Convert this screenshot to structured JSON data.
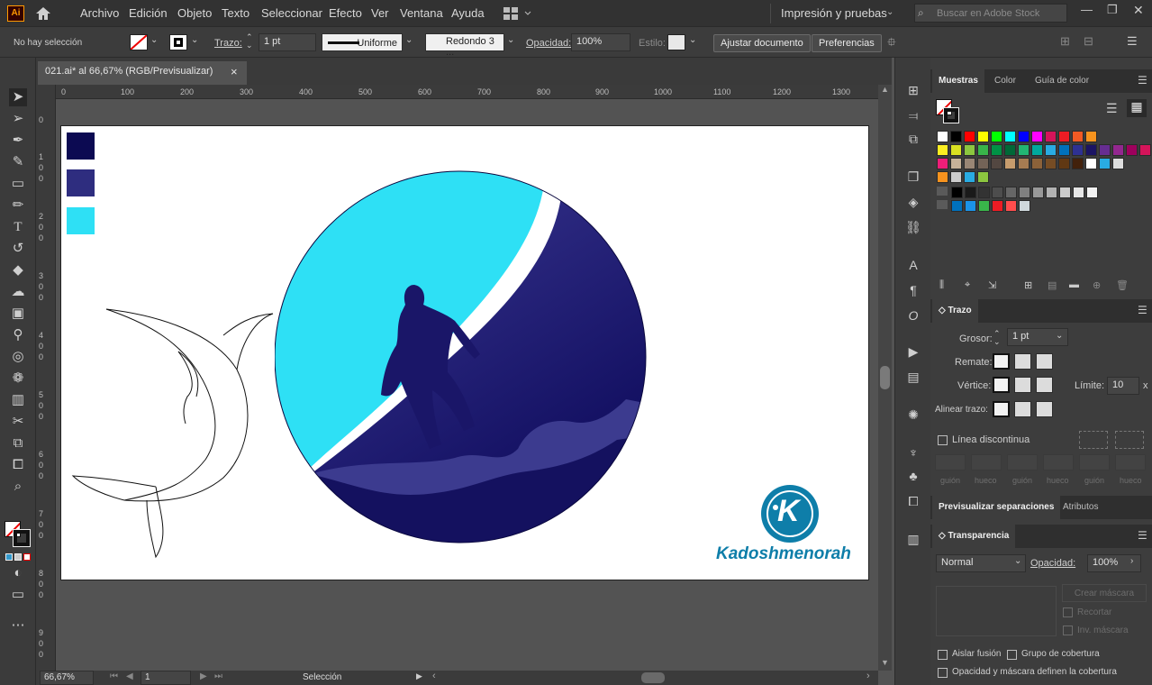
{
  "menubar": {
    "app_icon": "Ai",
    "items": [
      "Archivo",
      "Edición",
      "Objeto",
      "Texto",
      "Seleccionar",
      "Efecto",
      "Ver",
      "Ventana",
      "Ayuda"
    ],
    "workspace": "Impresión y pruebas",
    "search_placeholder": "Buscar en Adobe Stock"
  },
  "control": {
    "selection": "No hay selección",
    "stroke_label": "Trazo:",
    "stroke_value": "1 pt",
    "profile": "Uniforme",
    "brush": "Redondo 3 ...",
    "opacity_label": "Opacidad:",
    "opacity": "100%",
    "style_label": "Estilo:",
    "adjust_doc": "Ajustar documento",
    "prefs": "Preferencias"
  },
  "document": {
    "tab_title": "021.ai* al 66,67% (RGB/Previsualizar)",
    "close": "×"
  },
  "ruler": {
    "h_ticks": [
      "0",
      "100",
      "200",
      "300",
      "400",
      "500",
      "600",
      "700",
      "800",
      "900",
      "1000",
      "1100",
      "1200",
      "1300"
    ],
    "v_ticks": [
      "0",
      "100",
      "200",
      "300",
      "400",
      "500",
      "600",
      "700",
      "800",
      "900"
    ]
  },
  "artwork": {
    "logo_letter": "K",
    "brand": "Kadoshmenorah",
    "palette": [
      "#0c0a52",
      "#2e2d7f",
      "#2ee0f5"
    ]
  },
  "status": {
    "zoom": "66,67%",
    "artboard": "1",
    "tool": "Selección"
  },
  "swatches_panel": {
    "tabs": [
      "Muestras",
      "Color",
      "Guía de color"
    ],
    "rows": [
      [
        "#ffffff",
        "#000000",
        "#ff0000",
        "#ffff00",
        "#00ff00",
        "#00ffff",
        "#0000ff",
        "#ff00ff",
        "#d4145a",
        "#ed1c24",
        "#f15a24",
        "#f7931e"
      ],
      [
        "#fcee21",
        "#d9e021",
        "#8cc63f",
        "#39b54a",
        "#009245",
        "#006837",
        "#22b573",
        "#00a99d",
        "#29abe2",
        "#0071bc",
        "#2e3192",
        "#1b1464",
        "#662d91",
        "#93278f",
        "#9e005d",
        "#d4145a"
      ],
      [
        "#ed1e79",
        "#c7b299",
        "#998675",
        "#736357",
        "#534741",
        "#c69c6d",
        "#a67c52",
        "#8c6239",
        "#754c24",
        "#603813",
        "#42210b",
        "#ffffff",
        "#29abe2",
        "#dddddd"
      ],
      [
        "#f7931e",
        "#cccccc",
        "#29abe2",
        "#8cc63f"
      ],
      [
        "#000000",
        "#1a1a1a",
        "#333333",
        "#4d4d4d",
        "#666666",
        "#808080",
        "#999999",
        "#b3b3b3",
        "#cccccc",
        "#e6e6e6",
        "#f2f2f2"
      ],
      [
        "#0071bc",
        "#1b93e8",
        "#39b54a",
        "#ed1c24",
        "#ff4d4d",
        "#cfd8dc"
      ]
    ]
  },
  "stroke_panel": {
    "title": "Trazo",
    "weight_label": "Grosor:",
    "weight": "1 pt",
    "cap_label": "Remate:",
    "corner_label": "Vértice:",
    "limit_label": "Límite:",
    "limit": "10",
    "limit_unit": "x",
    "align_label": "Alinear trazo:",
    "dashed_label": "Línea discontinua",
    "dash_labels": [
      "guión",
      "hueco",
      "guión",
      "hueco",
      "guión",
      "hueco"
    ]
  },
  "sep_tabs": [
    "Previsualizar separaciones",
    "Atributos"
  ],
  "transparency_panel": {
    "title": "Transparencia",
    "mode": "Normal",
    "opacity_label": "Opacidad:",
    "opacity": "100%",
    "create_mask": "Crear máscara",
    "clip": "Recortar",
    "invert": "Inv. máscara",
    "isolate": "Aislar fusión",
    "knockout": "Grupo de cobertura",
    "opacity_mask": "Opacidad y máscara definen la cobertura"
  }
}
